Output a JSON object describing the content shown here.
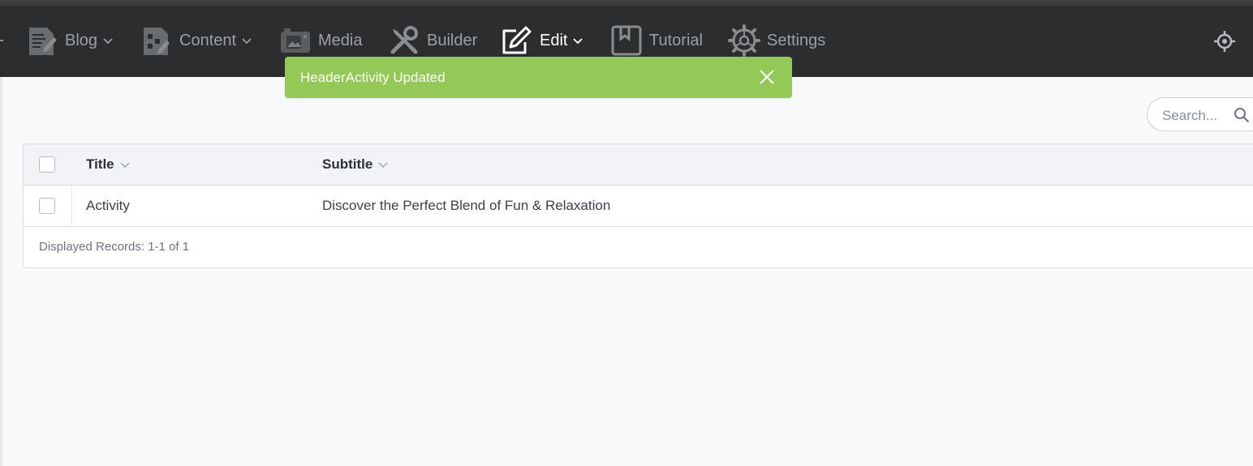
{
  "nav": {
    "items": [
      {
        "label": "Blog",
        "icon": "blog-document-icon",
        "has_dropdown": true
      },
      {
        "label": "Content",
        "icon": "content-document-icon",
        "has_dropdown": true
      },
      {
        "label": "Media",
        "icon": "media-camera-icon",
        "has_dropdown": false
      },
      {
        "label": "Builder",
        "icon": "builder-tools-icon",
        "has_dropdown": false
      },
      {
        "label": "Edit",
        "icon": "edit-pencil-icon",
        "has_dropdown": true,
        "active": true
      },
      {
        "label": "Tutorial",
        "icon": "tutorial-bookmark-icon",
        "has_dropdown": false
      },
      {
        "label": "Settings",
        "icon": "settings-gear-icon",
        "has_dropdown": false
      }
    ],
    "right_icon": "locate-crosshair-icon"
  },
  "toast": {
    "message": "HeaderActivity Updated",
    "color": "#94c957"
  },
  "search": {
    "placeholder": "Search...",
    "value": ""
  },
  "table": {
    "columns": [
      "Title",
      "Subtitle"
    ],
    "rows": [
      {
        "title": "Activity",
        "subtitle": "Discover the Perfect Blend of Fun & Relaxation"
      }
    ],
    "footer": "Displayed Records: 1-1 of 1"
  },
  "colors": {
    "navbar": "#2b2d2f",
    "nav_text": "#9aa0a6",
    "nav_active_text": "#ffffff",
    "page_bg": "#f8f9fa"
  }
}
